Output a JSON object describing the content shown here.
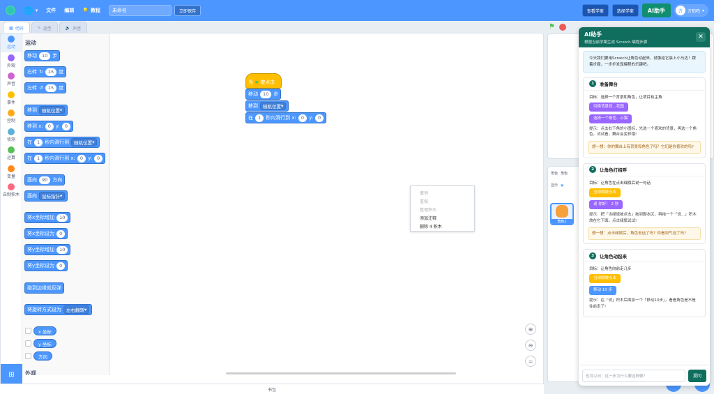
{
  "menubar": {
    "file": "文件",
    "edit": "编辑",
    "tutorial": "教程",
    "project_title": "未命名",
    "save": "立即保存",
    "view_project": "查看学案",
    "select_project": "选择学案",
    "ai_assistant": "AI助手",
    "username": "方柏鸣",
    "avatar_initial": "方"
  },
  "tabs": {
    "code": "代码",
    "costumes": "造型",
    "sounds": "声音"
  },
  "categories": [
    {
      "label": "运动",
      "color": "#4c97ff"
    },
    {
      "label": "外观",
      "color": "#9966ff"
    },
    {
      "label": "声音",
      "color": "#cf63cf"
    },
    {
      "label": "事件",
      "color": "#ffbf00"
    },
    {
      "label": "控制",
      "color": "#ffab19"
    },
    {
      "label": "侦测",
      "color": "#5cb1d6"
    },
    {
      "label": "运算",
      "color": "#59c059"
    },
    {
      "label": "变量",
      "color": "#ff8c1a"
    },
    {
      "label": "自制积木",
      "color": "#ff6680"
    }
  ],
  "palette": {
    "title": "运动",
    "move": "移动",
    "move_n": "10",
    "move_unit": "步",
    "turn_right": "右转",
    "turn_r_n": "15",
    "deg": "度",
    "turn_left": "左转",
    "turn_l_n": "15",
    "goto": "移到",
    "goto_dd": "随机位置",
    "goto_xy": "移到 x:",
    "zero": "0",
    "y": "y:",
    "glide": "在",
    "glide_n": "1",
    "glide_to": "秒内滑行到",
    "glide_dd": "随机位置",
    "glide_xy": "秒内滑行到 x:",
    "point": "面向",
    "point_n": "90",
    "point_dir": "方向",
    "point_to": "面向",
    "point_dd": "鼠标指针",
    "change_x": "将x坐标增加",
    "change_x_n": "10",
    "set_x": "将x坐标设为",
    "set_x_n": "0",
    "change_y": "将y坐标增加",
    "change_y_n": "10",
    "set_y": "将y坐标设为",
    "set_y_n": "0",
    "bounce": "碰到边缘就反弹",
    "rot": "将旋转方式设为",
    "rot_dd": "左右翻转",
    "rep_x": "x 坐标",
    "rep_y": "y 坐标",
    "rep_dir": "方向",
    "next_section": "外观"
  },
  "script": {
    "hat_when": "当",
    "hat_clicked": "被点击",
    "move": "移动",
    "move_n": "10",
    "move_unit": "步",
    "goto": "移到",
    "goto_dd": "随机位置",
    "glide_in": "在",
    "glide_n": "1",
    "glide_xy": "秒内滑行到 x:",
    "x": "0",
    "y_label": "y:",
    "y": "0"
  },
  "context_menu": [
    "撤销",
    "重做",
    "整理积木",
    "添加注释",
    "删除 4 积木"
  ],
  "backpack": "书包",
  "sprite_pane": {
    "tab_sprite": "角色",
    "tab_sprite2": "角色",
    "show": "显示",
    "sprite_name": "角色1"
  },
  "ai": {
    "title": "AI助手",
    "subtitle": "根据当前学案生成 Scratch 编程步骤",
    "intro": "今天我们要用Scratch让角色动起来，就像给它装上小马达！跟着步骤，一步步发现编程的乐趣吧。",
    "steps": [
      {
        "num": "1",
        "title": "准备舞台",
        "goal": "目标：选择一个背景和角色，让项目有主角",
        "chips": [
          {
            "text": "切换背景到...花园",
            "color": "purple"
          },
          {
            "text": "选择一个角色...小猫",
            "color": "purple"
          }
        ],
        "tip": "提示：点击右下角的小图标，先选一个喜欢的背景，再选一个角色。试试看，舞台会变样哦!",
        "think": "想一想：你的舞台上有背景和角色了吗？它们是你喜欢的吗?"
      },
      {
        "num": "2",
        "title": "让角色打招呼",
        "goal": "目标：让角色在点击绿旗后说一句话",
        "chips": [
          {
            "text": "当绿旗被点击",
            "color": "yellow"
          },
          {
            "text": "说 你好！ 2 秒",
            "color": "purple"
          }
        ],
        "tip": "提示：把「当绿旗被点击」拖到脚本区，再拖一个「说...」积木放在它下面。点击绿旗试试!",
        "think": "想一想：点击绿旗后，角色说话了吗？你看到气泡了吗?"
      },
      {
        "num": "3",
        "title": "让角色动起来",
        "goal": "目标：让角色向前走几步",
        "chips": [
          {
            "text": "当绿旗被点击",
            "color": "yellow"
          },
          {
            "text": "移动 10 步",
            "color": "blue"
          }
        ],
        "tip": "提示：在「说」积木后面加一个「移动10步」，看看角色是不是往前走了!",
        "think": ""
      }
    ],
    "input_placeholder": "也可以问：这一步为什么要这样做?",
    "send": "提问"
  }
}
